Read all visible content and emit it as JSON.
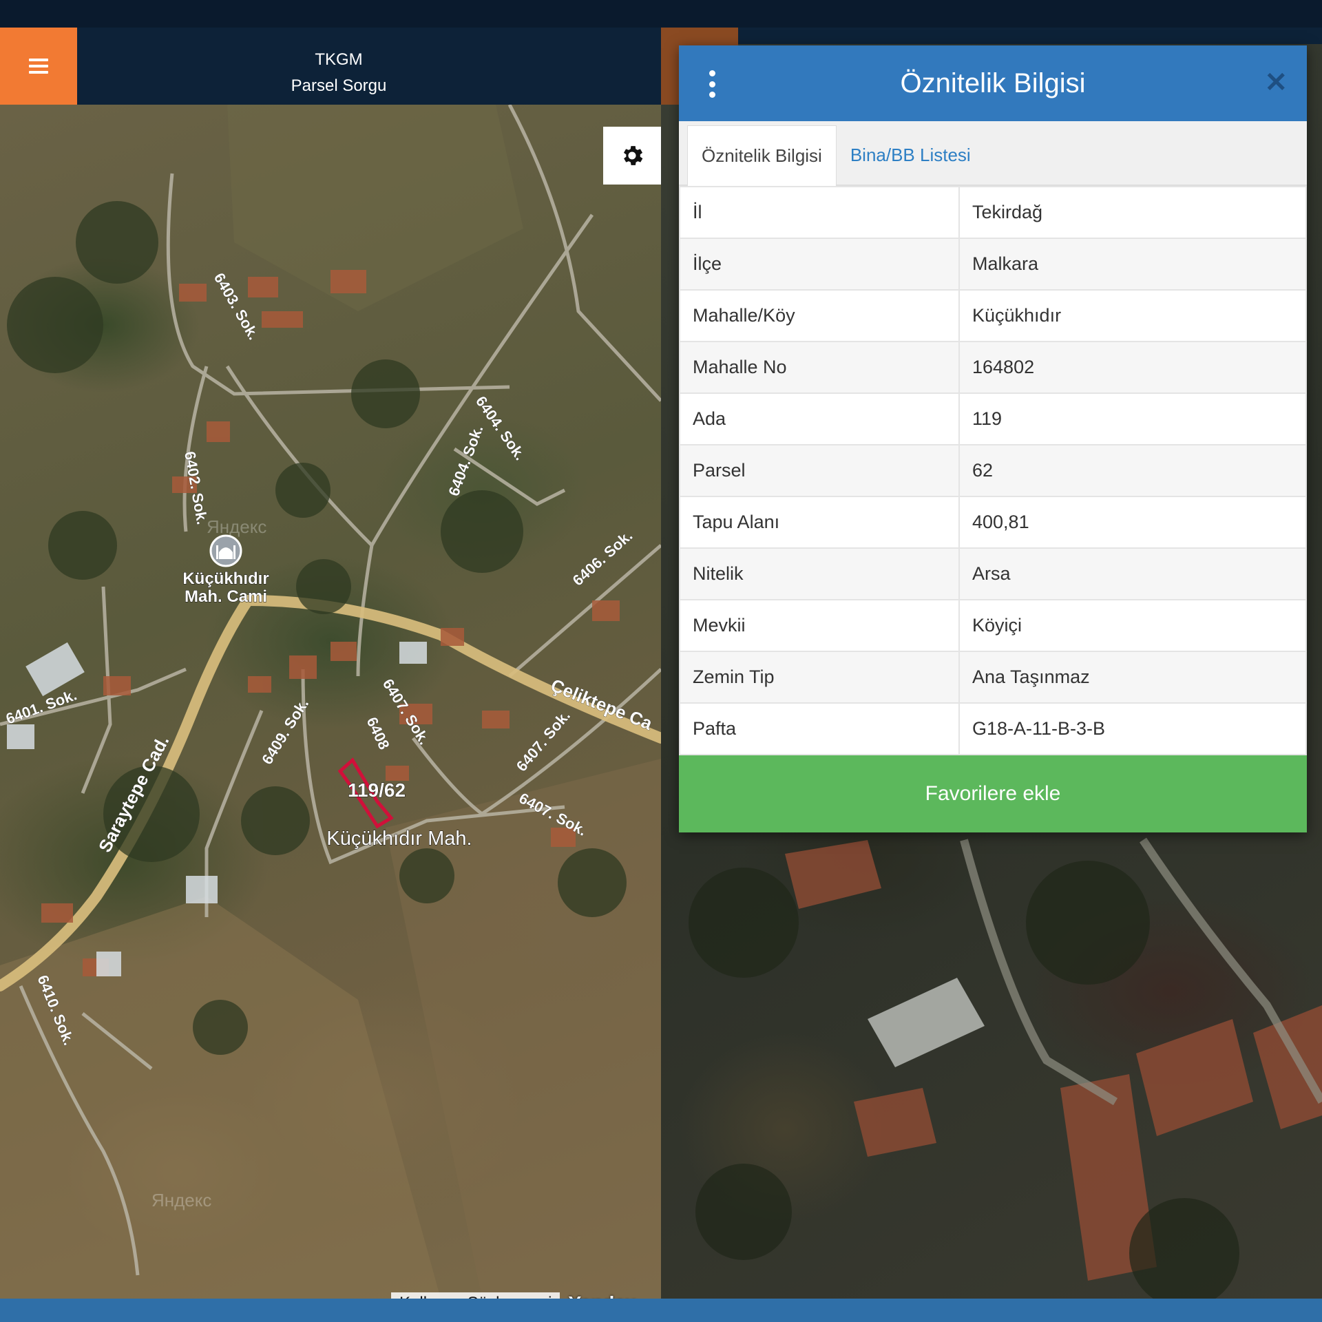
{
  "header": {
    "app_name": "TKGM",
    "app_subtitle": "Parsel Sorgu"
  },
  "map": {
    "parcel_label": "119/62",
    "neighborhood_label": "Küçükhıdır Mah.",
    "mosque_label_line1": "Küçükhıdır",
    "mosque_label_line2": "Mah. Cami",
    "street_labels": [
      "6403. Sok.",
      "6404. Sok.",
      "6404. Sok.",
      "6402. Sok.",
      "6406. Sok.",
      "6401. Sok.",
      "6409. Sok.",
      "6407. Sok.",
      "6407. Sok.",
      "6407. Sok.",
      "6408",
      "6410. Sok.",
      "Saraytepe Cad.",
      "Çeliktepe Ca"
    ],
    "watermarks": [
      "Яндекс",
      "Яндекс"
    ],
    "agreement_link": "Kullanıcı Sözleşmesi",
    "provider": "Yandex"
  },
  "dialog": {
    "title": "Öznitelik Bilgisi",
    "tabs": [
      {
        "label": "Öznitelik Bilgisi"
      },
      {
        "label": "Bina/BB Listesi"
      }
    ],
    "rows": [
      {
        "key": "İl",
        "value": "Tekirdağ"
      },
      {
        "key": "İlçe",
        "value": "Malkara"
      },
      {
        "key": "Mahalle/Köy",
        "value": "Küçükhıdır"
      },
      {
        "key": "Mahalle No",
        "value": "164802"
      },
      {
        "key": "Ada",
        "value": "119"
      },
      {
        "key": "Parsel",
        "value": "62"
      },
      {
        "key": "Tapu Alanı",
        "value": "400,81"
      },
      {
        "key": "Nitelik",
        "value": "Arsa"
      },
      {
        "key": "Mevkii",
        "value": "Köyiçi"
      },
      {
        "key": "Zemin Tip",
        "value": "Ana Taşınmaz"
      },
      {
        "key": "Pafta",
        "value": "G18-A-11-B-3-B"
      }
    ],
    "favorite_button": "Favorilere ekle"
  },
  "colors": {
    "accent_orange": "#f27a33",
    "header_navy": "#0d2238",
    "dialog_blue": "#3279bd",
    "button_green": "#5cb85c",
    "parcel_red": "#d0103a"
  },
  "icons": {
    "menu": "hamburger-icon",
    "settings": "gear-icon",
    "more": "kebab-icon",
    "close": "close-icon",
    "mosque": "mosque-icon"
  }
}
